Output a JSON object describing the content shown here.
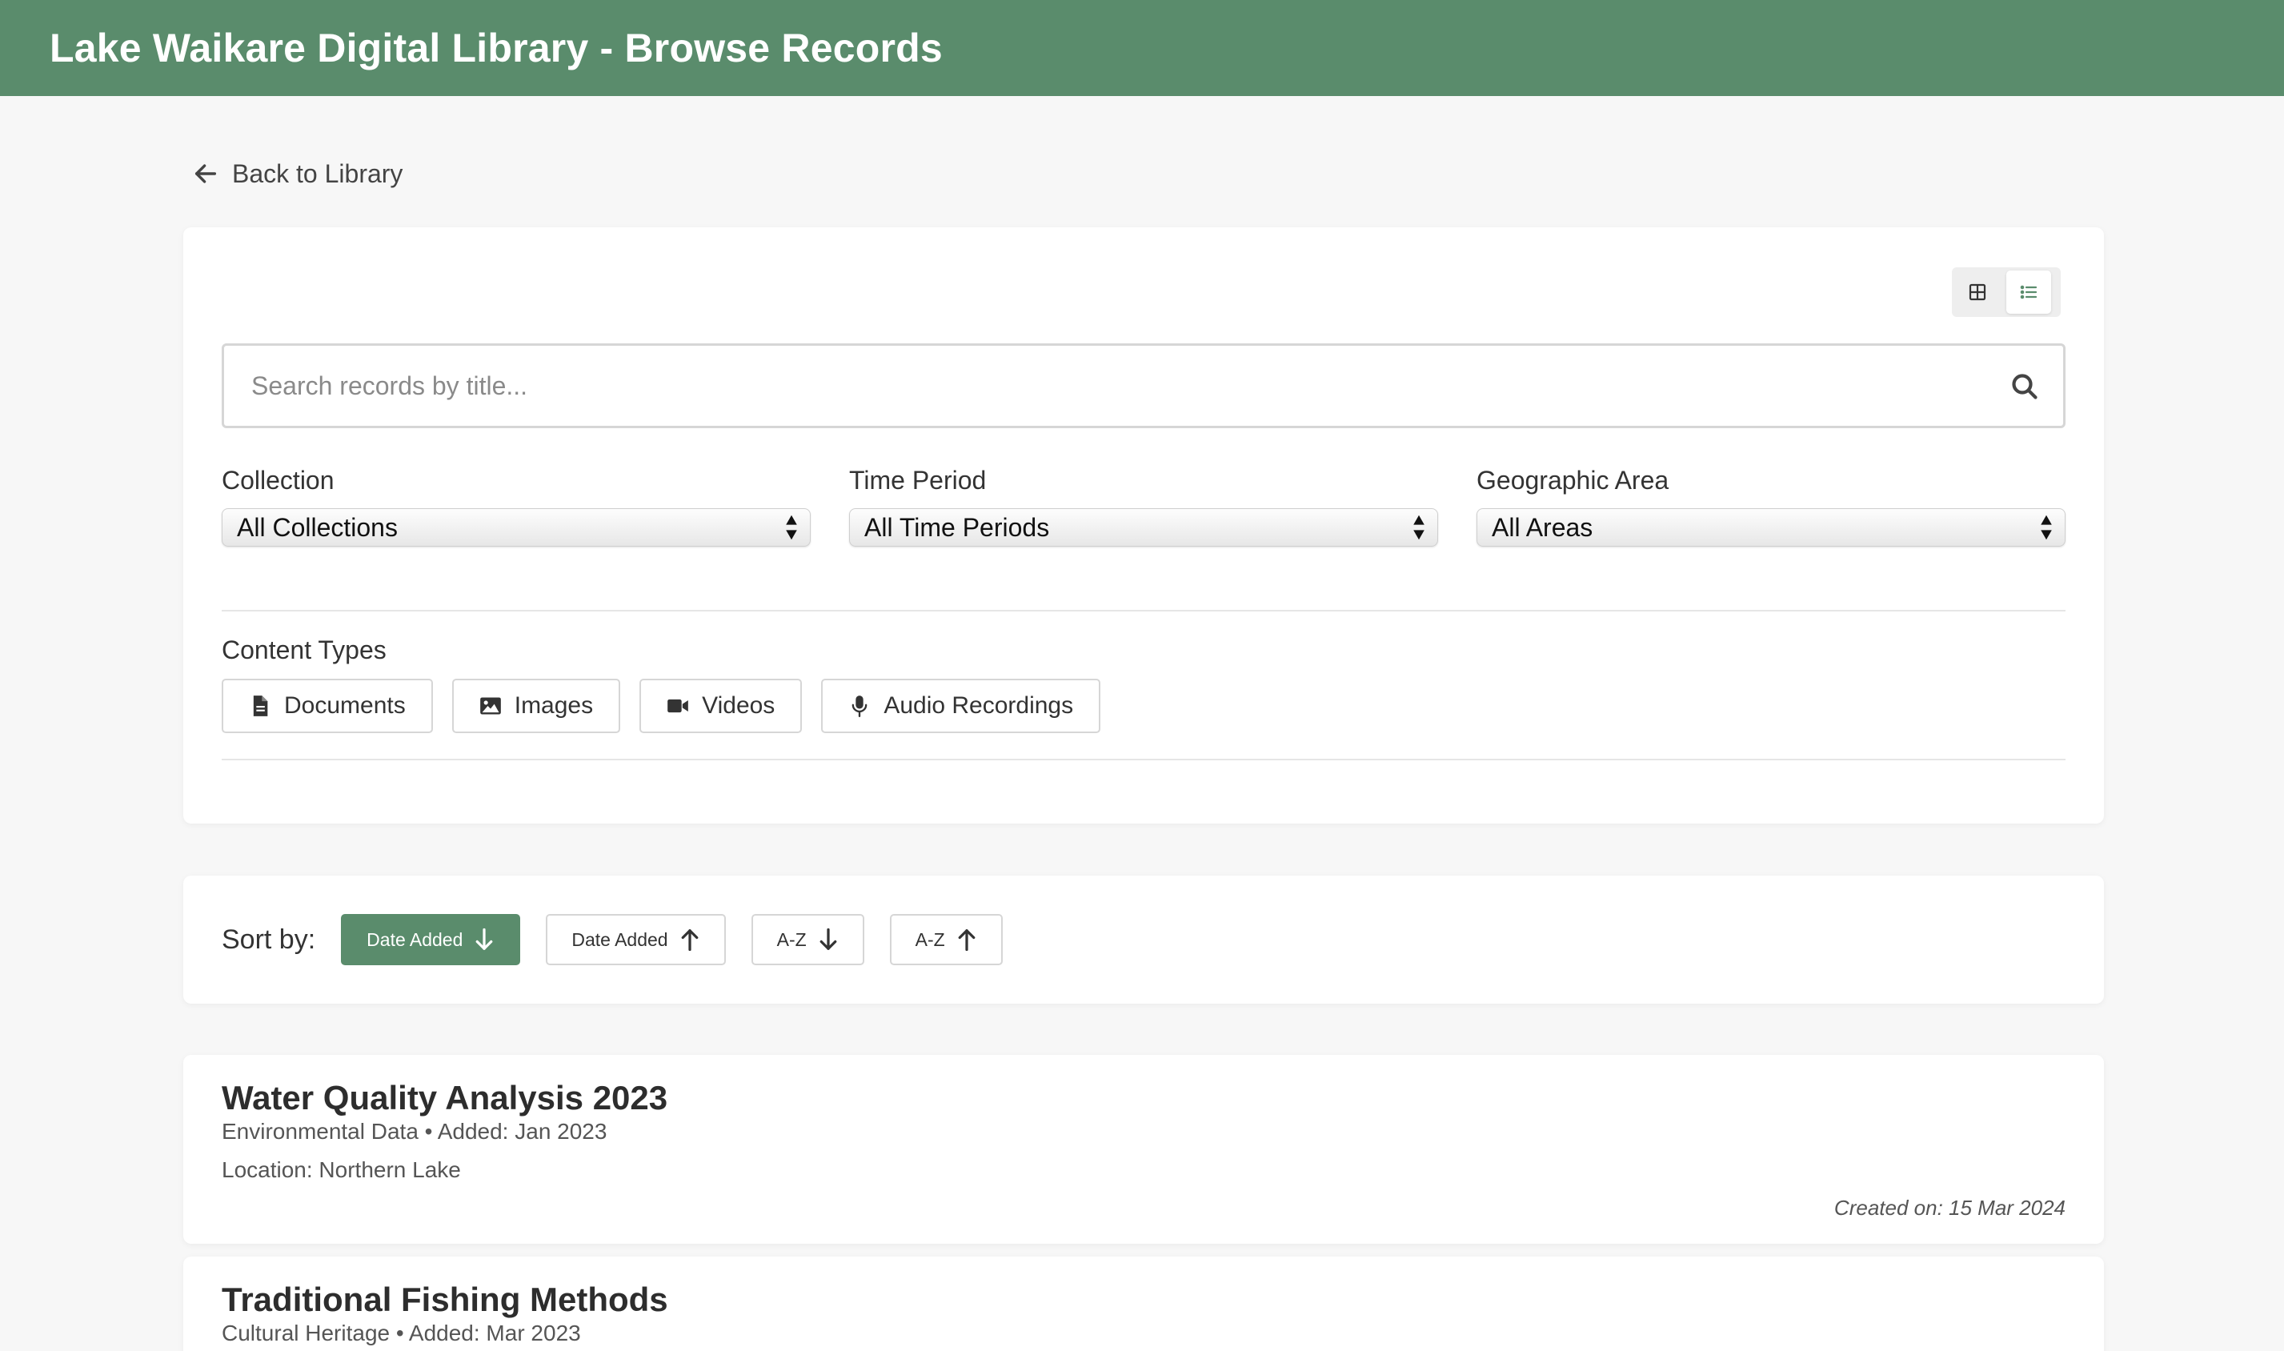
{
  "header": {
    "title": "Lake Waikare Digital Library - Browse Records"
  },
  "nav": {
    "back_label": "Back to Library"
  },
  "search": {
    "placeholder": "Search records by title..."
  },
  "filters": {
    "collection": {
      "label": "Collection",
      "selected": "All Collections"
    },
    "time_period": {
      "label": "Time Period",
      "selected": "All Time Periods"
    },
    "geographic_area": {
      "label": "Geographic Area",
      "selected": "All Areas"
    }
  },
  "content_types": {
    "label": "Content Types",
    "items": [
      {
        "label": "Documents",
        "icon": "document-icon"
      },
      {
        "label": "Images",
        "icon": "image-icon"
      },
      {
        "label": "Videos",
        "icon": "video-icon"
      },
      {
        "label": "Audio Recordings",
        "icon": "microphone-icon"
      }
    ]
  },
  "view_toggle": {
    "active": "list",
    "options": [
      "grid",
      "list"
    ]
  },
  "sort": {
    "label": "Sort by:",
    "options": [
      {
        "label": "Date Added",
        "direction": "down",
        "active": true
      },
      {
        "label": "Date Added",
        "direction": "up",
        "active": false
      },
      {
        "label": "A-Z",
        "direction": "down",
        "active": false
      },
      {
        "label": "A-Z",
        "direction": "up",
        "active": false
      }
    ]
  },
  "records": [
    {
      "title": "Water Quality Analysis 2023",
      "meta": "Environmental Data • Added: Jan 2023",
      "location": "Location: Northern Lake",
      "created": "Created on: 15 Mar 2024"
    },
    {
      "title": "Traditional Fishing Methods",
      "meta": "Cultural Heritage • Added: Mar 2023"
    }
  ],
  "colors": {
    "accent": "#5a8c6c",
    "background": "#f7f7f7",
    "card": "#ffffff"
  }
}
